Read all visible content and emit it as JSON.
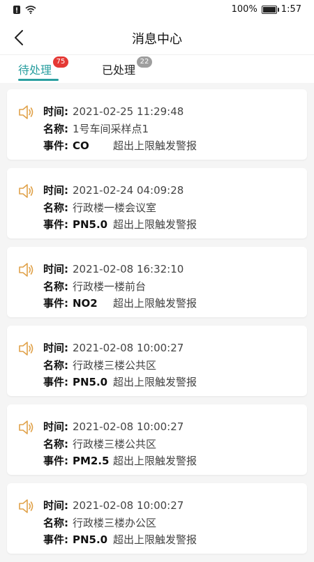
{
  "status_bar": {
    "battery_percent": "100%",
    "time": "1:57",
    "battery_level": 1.0
  },
  "header": {
    "title": "消息中心"
  },
  "tabs": [
    {
      "label": "待处理",
      "badge": "75",
      "active": true
    },
    {
      "label": "已处理",
      "badge": "22",
      "active": false
    }
  ],
  "labels": {
    "time": "时间:",
    "name": "名称:",
    "event": "事件:"
  },
  "messages": [
    {
      "time": "2021-02-25 11:29:48",
      "name": "1号车间采样点1",
      "code": "CO",
      "desc": "超出上限触发警报"
    },
    {
      "time": "2021-02-24 04:09:28",
      "name": "行政楼一楼会议室",
      "code": "PN5.0",
      "desc": "超出上限触发警报"
    },
    {
      "time": "2021-02-08 16:32:10",
      "name": "行政楼一楼前台",
      "code": "NO2",
      "desc": "超出上限触发警报"
    },
    {
      "time": "2021-02-08 10:00:27",
      "name": "行政楼三楼公共区",
      "code": "PN5.0",
      "desc": "超出上限触发警报"
    },
    {
      "time": "2021-02-08 10:00:27",
      "name": "行政楼三楼公共区",
      "code": "PM2.5",
      "desc": "超出上限触发警报"
    },
    {
      "time": "2021-02-08 10:00:27",
      "name": "行政楼三楼办公区",
      "code": "PN5.0",
      "desc": "超出上限触发警报"
    }
  ],
  "colors": {
    "accent": "#2a9fa0",
    "badge_red": "#e53935",
    "badge_gray": "#9e9e9e",
    "speaker": "#e0a24a"
  }
}
